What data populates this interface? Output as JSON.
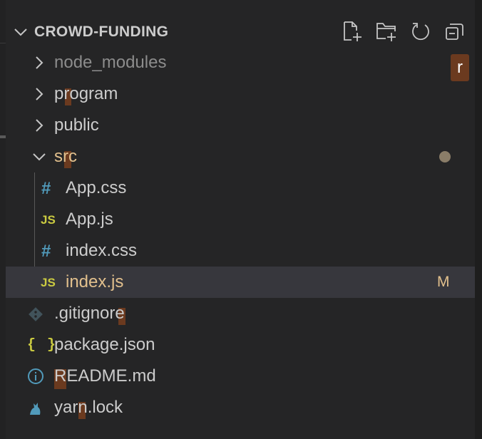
{
  "explorer": {
    "title": "CROWD-FUNDING",
    "actions": [
      "new-file-icon",
      "new-folder-icon",
      "refresh-icon",
      "collapse-all-icon"
    ],
    "find_badge": "r"
  },
  "tree": [
    {
      "name": "node_modules",
      "kind": "folder",
      "expanded": false,
      "dimmed": true
    },
    {
      "name": "program",
      "kind": "folder",
      "expanded": false
    },
    {
      "name": "public",
      "kind": "folder",
      "expanded": false
    },
    {
      "name": "src",
      "kind": "folder",
      "expanded": true,
      "modified": true
    },
    {
      "name": "App.css",
      "kind": "file",
      "icon": "css-icon",
      "icon_text": "#"
    },
    {
      "name": "App.js",
      "kind": "file",
      "icon": "js-icon",
      "icon_text": "JS"
    },
    {
      "name": "index.css",
      "kind": "file",
      "icon": "css-icon",
      "icon_text": "#"
    },
    {
      "name": "index.js",
      "kind": "file",
      "icon": "js-icon",
      "icon_text": "JS",
      "selected": true,
      "status": "M"
    },
    {
      "name": ".gitignore",
      "kind": "file",
      "icon": "git-icon"
    },
    {
      "name": "package.json",
      "kind": "file",
      "icon": "json-icon",
      "icon_text": "{ }"
    },
    {
      "name": "README.md",
      "kind": "file",
      "icon": "info-icon"
    },
    {
      "name": "yarn.lock",
      "kind": "file",
      "icon": "yarn-icon"
    }
  ],
  "colors": {
    "background": "#252526",
    "selected_row": "#37373d",
    "text": "#cccccc",
    "dimmed_text": "#8c8c8c",
    "modified_text": "#e2c08d",
    "match_highlight": "#6b3a1f",
    "js_icon": "#cbcb41",
    "css_icon": "#519aba"
  }
}
